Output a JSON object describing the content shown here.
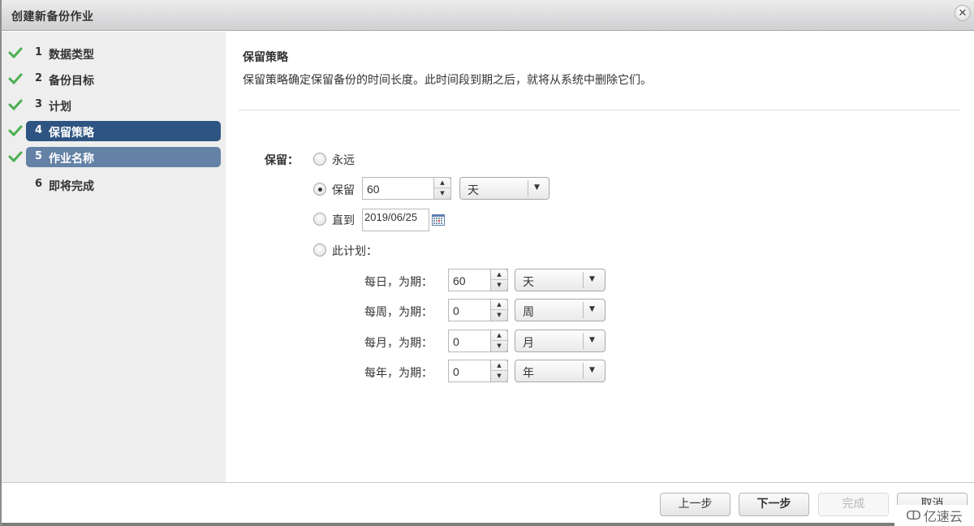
{
  "window": {
    "title": "创建新备份作业",
    "close_icon": "close-circle-icon"
  },
  "steps": [
    {
      "num": "1",
      "label": "数据类型",
      "completed": true,
      "state": "normal"
    },
    {
      "num": "2",
      "label": "备份目标",
      "completed": true,
      "state": "normal"
    },
    {
      "num": "3",
      "label": "计划",
      "completed": true,
      "state": "normal"
    },
    {
      "num": "4",
      "label": "保留策略",
      "completed": true,
      "state": "active"
    },
    {
      "num": "5",
      "label": "作业名称",
      "completed": true,
      "state": "hover"
    },
    {
      "num": "6",
      "label": "即将完成",
      "completed": false,
      "state": "normal"
    }
  ],
  "content": {
    "title": "保留策略",
    "description": "保留策略确定保留备份的时间长度。此时间段到期之后，就将从系统中删除它们。",
    "retain_label": "保留：",
    "options": {
      "forever": {
        "label": "永远",
        "checked": false
      },
      "keep": {
        "label": "保留",
        "checked": true,
        "value": "60",
        "unit": "天"
      },
      "until": {
        "label": "直到",
        "checked": false,
        "date": "2019/06/25"
      },
      "schedule": {
        "label": "此计划：",
        "checked": false
      }
    },
    "schedule_rows": [
      {
        "label": "每日，为期：",
        "value": "60",
        "unit": "天"
      },
      {
        "label": "每周，为期：",
        "value": "0",
        "unit": "周"
      },
      {
        "label": "每月，为期：",
        "value": "0",
        "unit": "月"
      },
      {
        "label": "每年，为期：",
        "value": "0",
        "unit": "年"
      }
    ]
  },
  "footer": {
    "back": "上一步",
    "next": "下一步",
    "finish": "完成",
    "cancel": "取消"
  },
  "watermark": "亿速云",
  "colors": {
    "active_step": "#2e5481",
    "hover_step": "#6482a6",
    "check": "#4caf50"
  }
}
